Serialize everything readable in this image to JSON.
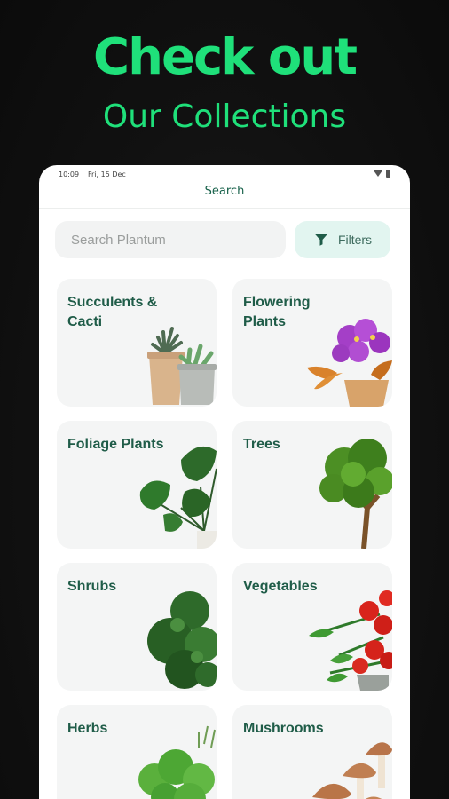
{
  "promo": {
    "title": "Check out",
    "subtitle": "Our Collections"
  },
  "status_bar": {
    "time": "10:09",
    "date": "Fri, 15 Dec"
  },
  "header": {
    "title": "Search"
  },
  "search": {
    "placeholder": "Search Plantum"
  },
  "filters": {
    "label": "Filters"
  },
  "categories": [
    {
      "label": "Succulents & Cacti"
    },
    {
      "label": "Flowering Plants"
    },
    {
      "label": "Foliage Plants"
    },
    {
      "label": "Trees"
    },
    {
      "label": "Shrubs"
    },
    {
      "label": "Vegetables"
    },
    {
      "label": "Herbs"
    },
    {
      "label": "Mushrooms"
    }
  ],
  "colors": {
    "accent": "#1fe07a",
    "label": "#1f5c48",
    "card_bg": "#f4f5f5",
    "filter_bg": "#e2f5f0"
  }
}
